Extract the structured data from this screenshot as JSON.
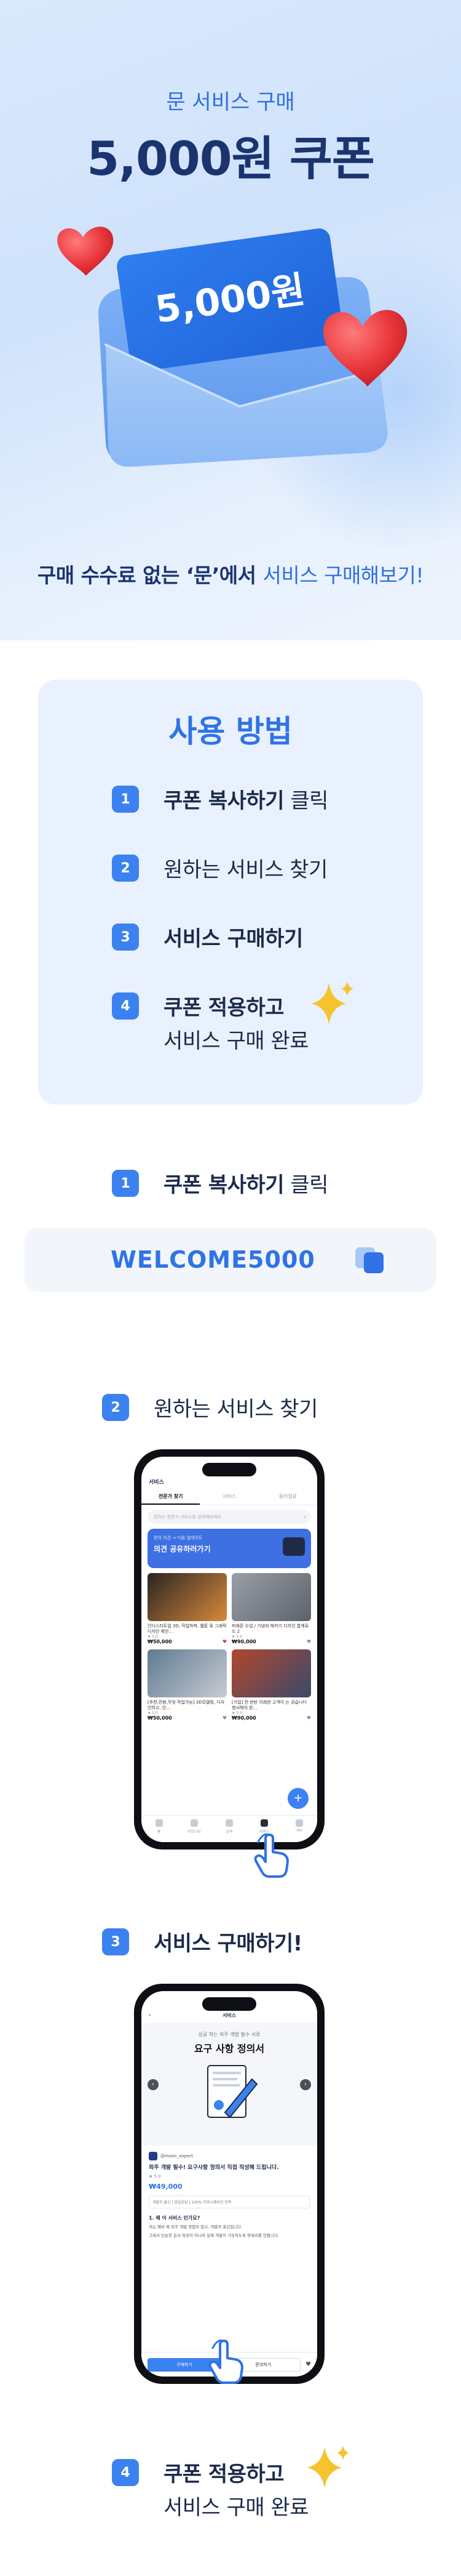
{
  "hero": {
    "subtitle": "문 서비스 구매",
    "title": "5,000원 쿠폰",
    "envelope_card_text": "5,000원",
    "caption_part1": "구매 수수료 없는 ‘문’에서 ",
    "caption_part2": "서비스 구매해보기!"
  },
  "howto": {
    "title": "사용 방법",
    "steps": [
      {
        "num": "1",
        "bold": "쿠폰 복사하기",
        "rest": " 클릭"
      },
      {
        "num": "2",
        "bold": "",
        "rest": "원하는 서비스 찾기"
      },
      {
        "num": "3",
        "bold": "서비스 구매하기",
        "rest": ""
      },
      {
        "num": "4",
        "bold": "쿠폰 적용하고",
        "rest": "서비스 구매 완료"
      }
    ]
  },
  "section1": {
    "num": "1",
    "bold": "쿠폰 복사하기",
    "rest": " 클릭"
  },
  "coupon": {
    "code": "WELCOME5000",
    "copy_icon": "copy-icon"
  },
  "section2": {
    "num": "2",
    "label": "원하는 서비스 찾기",
    "phone": {
      "header": "서비스",
      "tabs": [
        "전문가 찾기",
        "서비스",
        "용어집료"
      ],
      "search_placeholder": "원하는 전문가 서비스를 검색해보세요",
      "banner_small": "문의 의견 → 다음 업데이트",
      "banner_title": "의견 공유하러가기",
      "cards": [
        {
          "title": "인디스타트업 3D, 작업하며, 웹툰 및 그래픽 디자인 제안…",
          "rating": "★ 5.0",
          "price": "₩50,000"
        },
        {
          "title": "피에몬 수업 / 기념비 해커기 디자인 합계로드 2",
          "rating": "★ 5.0",
          "price": "₩90,000"
        },
        {
          "title": "[추천,전용,무엇 작업가능] 3D모델링, 디자인하고, 인…",
          "rating": "★ 5.0",
          "price": "₩50,000"
        },
        {
          "title": "[기업] 전 반반 이래한 고객이 는 공습니다 행사해야 한…",
          "rating": "★ 5.0",
          "price": "₩90,000"
        }
      ],
      "nav": [
        "홈",
        "커뮤니티",
        "검색",
        "서비스",
        "MY"
      ]
    }
  },
  "section3": {
    "num": "3",
    "label": "서비스 구매하기!",
    "phone": {
      "header": "서비스",
      "eyebrow": "성공 하는 외주 개발 필수 서류",
      "title": "요구 사항 정의서",
      "seller": "@moon_expert",
      "product_title": "외주 개발 필수! 요구사항 정의서 직접 작성해 드립니다.",
      "rating": "★ 5.0",
      "price": "₩49,000",
      "meta": "개발자 출신 | 당일응답 | 100% 커뮤니케이션 만족",
      "q": "1. 왜 이 서비스 인가요?",
      "desc1": "저는 예비 제 외주 개발 경험이 많고, 개발자 출신입니다.",
      "desc2": "그래서 단순한 문서 작성이 아니라 실제 개발이 가능하도록 명세서를 만듭니다.",
      "buy_button": "구매하기",
      "inquiry_button": "문의하기"
    }
  },
  "section4": {
    "num": "4",
    "bold": "쿠폰 적용하고",
    "rest": "서비스 구매 완료"
  },
  "colors": {
    "accent": "#3b82f0",
    "navy": "#1b3470",
    "heart": "#e8353a"
  }
}
